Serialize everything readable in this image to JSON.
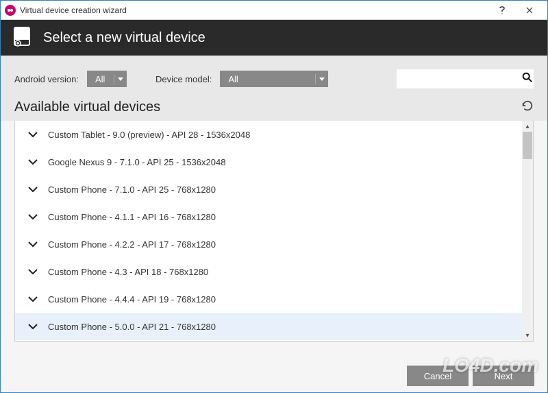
{
  "window": {
    "title": "Virtual device creation wizard"
  },
  "header": {
    "title": "Select a new virtual device"
  },
  "filters": {
    "android_label": "Android version:",
    "android_value": "All",
    "model_label": "Device model:",
    "model_value": "All",
    "search_value": ""
  },
  "section": {
    "title": "Available virtual devices"
  },
  "devices": [
    {
      "label": "Custom Tablet - 9.0 (preview) - API 28 - 1536x2048",
      "selected": false
    },
    {
      "label": "Google Nexus 9 - 7.1.0 - API 25 - 1536x2048",
      "selected": false
    },
    {
      "label": "Custom Phone - 7.1.0 - API 25 - 768x1280",
      "selected": false
    },
    {
      "label": "Custom Phone - 4.1.1 - API 16 - 768x1280",
      "selected": false
    },
    {
      "label": "Custom Phone - 4.2.2 - API 17 - 768x1280",
      "selected": false
    },
    {
      "label": "Custom Phone - 4.3 - API 18 - 768x1280",
      "selected": false
    },
    {
      "label": "Custom Phone - 4.4.4 - API 19 - 768x1280",
      "selected": false
    },
    {
      "label": "Custom Phone - 5.0.0 - API 21 - 768x1280",
      "selected": true
    }
  ],
  "footer": {
    "cancel": "Cancel",
    "next": "Next"
  },
  "watermark": "LO4D.com"
}
